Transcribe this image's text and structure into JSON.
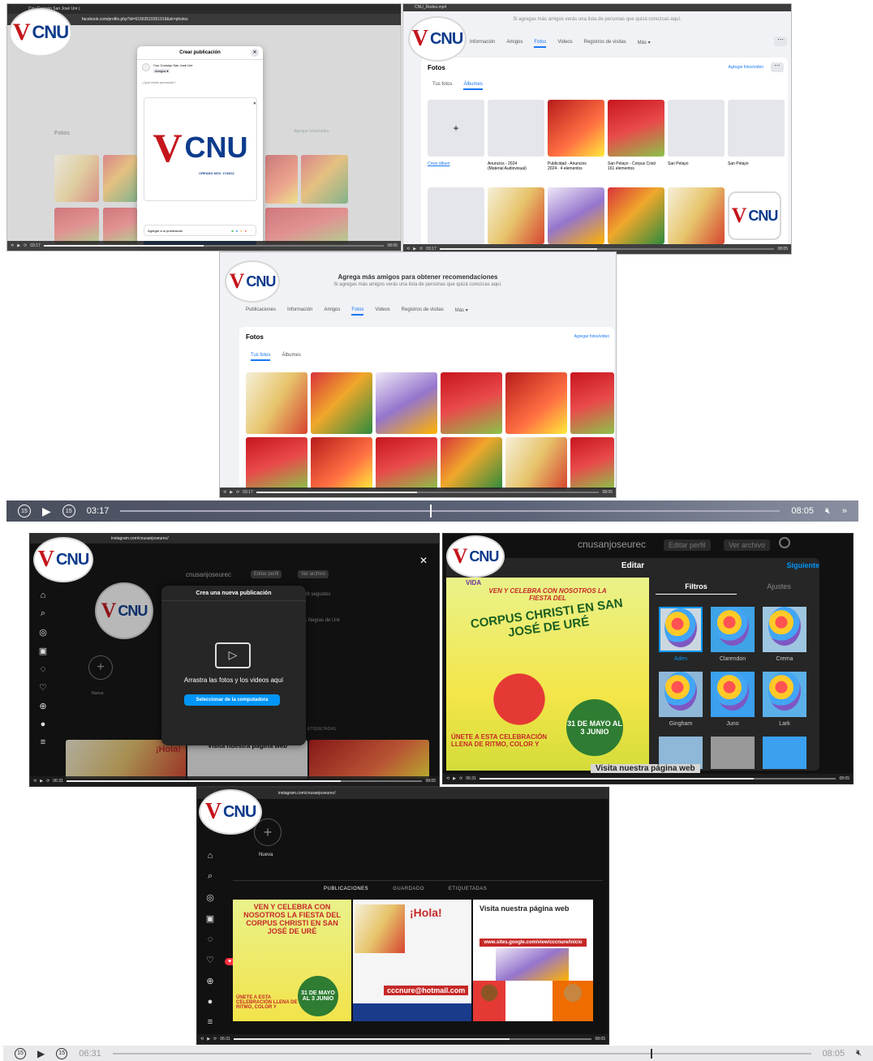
{
  "brand": {
    "logo_v": "V",
    "logo_text": "CNU"
  },
  "main_player_top": {
    "time_elapsed": "03:17",
    "time_total": "08:05",
    "progress": 0.47
  },
  "main_player_bottom": {
    "time_elapsed": "06:31",
    "time_total": "08:05",
    "progress": 0.77
  },
  "shot1": {
    "tab_title": "Cnu Consejo San José Uré (",
    "url": "facebook.com/profile.php?id=61563519351919&sk=photos",
    "dialog_title": "Crear publicación",
    "author": "Cnu Consejo San José Ure",
    "audience": "Amigos ▾",
    "prompt": "¿Qué estás pensando?",
    "logo_subtitle": "CREADO NOV. 17/2022",
    "add_to_post": "Agregar a tu publicación",
    "sidebar_heading": "Fotos",
    "sidebar_link": "Agregar fotos/video",
    "time_left": "03:17",
    "time_right": "08:05"
  },
  "shot2": {
    "file_title": "CNU_Redes.mp4",
    "notice": "Si agregas más amigos verás una lista de personas que quizá conozcas aquí.",
    "tabs": [
      "Información",
      "Amigos",
      "Fotos",
      "Videos",
      "Registros de visitas",
      "Más ▾"
    ],
    "active_tab": "Fotos",
    "heading": "Fotos",
    "add_link": "Agregar fotos/video",
    "subtabs": [
      "Tus fotos",
      "Álbumes"
    ],
    "active_subtab": "Álbumes",
    "albums": [
      {
        "title": "Crear álbum",
        "sub": ""
      },
      {
        "title": "Anuncios - 2024",
        "sub": "(Material Audiovisual)"
      },
      {
        "title": "Publicidad - Anuncios",
        "sub": "2024 · 4 elementos"
      },
      {
        "title": "San Pelayo - Corpus Cristi",
        "sub": "161 elementos"
      },
      {
        "title": "San Pelayo",
        "sub": ""
      },
      {
        "title": "San Pelayo",
        "sub": ""
      }
    ],
    "time_left": "03:17",
    "time_right": "08:05"
  },
  "shot3": {
    "banner_title": "Agrega más amigos para obtener recomendaciones",
    "banner_sub": "Si agregas más amigos verás una lista de personas que quizá conozcas aquí.",
    "tabs": [
      "Publicaciones",
      "Información",
      "Amigos",
      "Fotos",
      "Videos",
      "Registros de visitas",
      "Más ▾"
    ],
    "active_tab": "Fotos",
    "heading": "Fotos",
    "add_link": "Agregar fotos/video",
    "subtabs": [
      "Tus fotos",
      "Álbumes"
    ],
    "active_subtab": "Tus fotos",
    "time_left": "03:17",
    "time_right": "08:05"
  },
  "shot4": {
    "url": "instagram.com/cnusanjoseurec/",
    "username": "cnusanjoseurec",
    "edit_profile": "Editar perfil",
    "view_archive": "Ver archivo",
    "following": "38 seguidos",
    "bio": "s Negras de Uré",
    "modal_title": "Crea una nueva publicación",
    "drag_text": "Arrastra las fotos y los videos aquí",
    "select_button": "Seleccionar de la computadora",
    "new_label": "Nueva",
    "tagged": "ETIQUETADAS",
    "card1": "¡Hola!",
    "card2": "Visita nuestra página web",
    "close": "✕",
    "time_left": "06:31",
    "time_right": "08:05"
  },
  "shot5": {
    "username": "cnusanjoseurec",
    "edit_profile": "Editar perfil",
    "view_archive": "Ver archivo",
    "header": "Editar",
    "next": "Siguiente",
    "tab_filters": "Filtros",
    "tab_adjust": "Ajustes",
    "filters": [
      "Aden",
      "Clarendon",
      "Crema",
      "Gingham",
      "Juno",
      "Lark"
    ],
    "selected_filter": "Aden",
    "poster_brand": "VIDA",
    "poster_line1": "VEN Y CELEBRA CON NOSOTROS LA FIESTA DEL",
    "poster_line2": "CORPUS CHRISTI EN SAN JOSÉ DE URÉ",
    "poster_date": "31 DE MAYO AL 3 JUNIO",
    "poster_join": "ÚNETE A ESTA CELEBRACIÓN LLENA DE RITMO, COLOR Y",
    "footer": "Visita nuestra página web",
    "time_left": "06:31",
    "time_right": "08:05"
  },
  "shot6": {
    "url": "instagram.com/cnusanjoseurec/",
    "new_label": "Nueva",
    "tabs": [
      "PUBLICACIONES",
      "GUARDADO",
      "ETIQUETADAS"
    ],
    "post1_title": "VEN Y CELEBRA CON NOSOTROS LA FIESTA DEL CORPUS CHRISTI EN SAN JOSÉ DE URÉ",
    "post1_date": "31 DE MAYO AL 3 JUNIO",
    "post1_join": "ÚNETE A ESTA CELEBRACIÓN LLENA DE RITMO, COLOR Y",
    "post2_title": "¡Hola!",
    "post2_email": "cccnure@hotmail.com",
    "post3_title": "Visita nuestra página web",
    "post3_url": "www.sites.google.com/view/cccnure/inicio",
    "notif_count": "2",
    "time_left": "06:31",
    "time_right": "08:05"
  }
}
